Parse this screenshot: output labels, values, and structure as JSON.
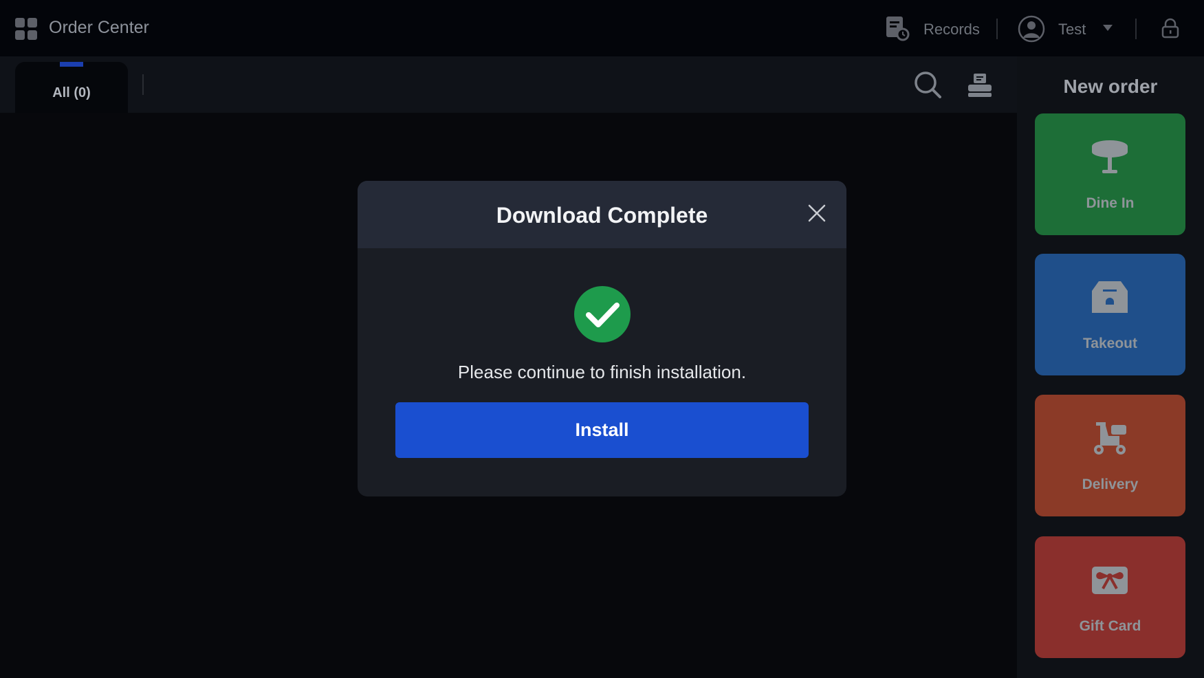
{
  "header": {
    "app_title": "Order Center",
    "records_label": "Records",
    "user_name": "Test",
    "icons": [
      "apps-grid-icon",
      "records-icon",
      "user-avatar-icon",
      "chevron-down-icon",
      "lock-icon"
    ]
  },
  "tabs": [
    {
      "label": "All (0)",
      "selected": true
    }
  ],
  "toolbar": {
    "icons": [
      "search-icon",
      "printer-icon"
    ]
  },
  "new_order": {
    "title": "New order",
    "options": [
      {
        "label": "Dine In",
        "icon": "table-icon",
        "color": "#1d6e37"
      },
      {
        "label": "Takeout",
        "icon": "takeout-box-icon",
        "color": "#1f4f8a"
      },
      {
        "label": "Delivery",
        "icon": "scooter-icon",
        "color": "#8b3a27"
      },
      {
        "label": "Gift Card",
        "icon": "gift-card-icon",
        "color": "#8a2f2c"
      }
    ]
  },
  "dialog": {
    "title": "Download Complete",
    "message": "Please continue to finish installation.",
    "install_label": "Install",
    "icon": "success-check-icon",
    "accent_color": "#1a4fd0",
    "success_color": "#1e9b4c"
  }
}
